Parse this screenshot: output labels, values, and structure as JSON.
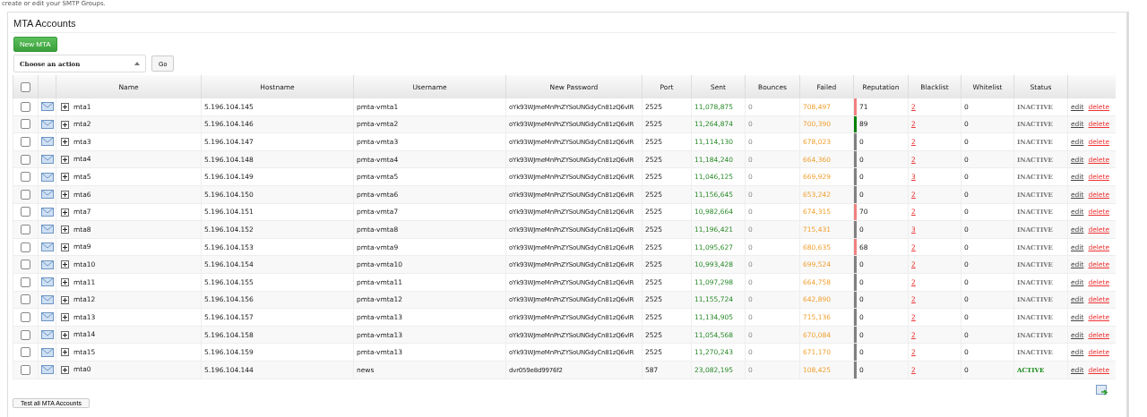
{
  "intro": "create or edit your SMTP Groups.",
  "panel_title": "MTA Accounts",
  "new_button": "New MTA",
  "action_select": {
    "value": "Choose an action"
  },
  "go_button": "Go",
  "header_checked": false,
  "columns": [
    "Name",
    "Hostname",
    "Username",
    "New Password",
    "Port",
    "Sent",
    "Bounces",
    "Failed",
    "Reputation",
    "Blacklist",
    "Whitelist",
    "Status"
  ],
  "rows": [
    {
      "checked": false,
      "name": "mta1",
      "hostname": "5.196.104.145",
      "username": "pmta-vmta1",
      "password": "oYk93WJmeMnPnZYSoUNGdyCn81zQ6vlR",
      "port": "2525",
      "sent": "11,078,875",
      "bounces": "0",
      "failed": "708,497",
      "reputation": "71",
      "color": "#f08080",
      "blacklist": "2",
      "whitelist": "0",
      "status": "INACTIVE",
      "active": false,
      "edit": "edit",
      "delete": "delete"
    },
    {
      "checked": false,
      "name": "mta2",
      "hostname": "5.196.104.146",
      "username": "pmta-vmta2",
      "password": "oYk93WJmeMnPnZYSoUNGdyCn81zQ6vlR",
      "port": "2525",
      "sent": "11,264,874",
      "bounces": "0",
      "failed": "700,390",
      "reputation": "89",
      "color": "#008000",
      "blacklist": "2",
      "whitelist": "0",
      "status": "INACTIVE",
      "active": false,
      "edit": "edit",
      "delete": "delete"
    },
    {
      "checked": false,
      "name": "mta3",
      "hostname": "5.196.104.147",
      "username": "pmta-vmta3",
      "password": "oYk93WJmeMnPnZYSoUNGdyCn81zQ6vlR",
      "port": "2525",
      "sent": "11,114,130",
      "bounces": "0",
      "failed": "678,023",
      "reputation": "0",
      "color": "#808080",
      "blacklist": "2",
      "whitelist": "0",
      "status": "INACTIVE",
      "active": false,
      "edit": "edit",
      "delete": "delete"
    },
    {
      "checked": false,
      "name": "mta4",
      "hostname": "5.196.104.148",
      "username": "pmta-vmta4",
      "password": "oYk93WJmeMnPnZYSoUNGdyCn81zQ6vlR",
      "port": "2525",
      "sent": "11,184,240",
      "bounces": "0",
      "failed": "664,360",
      "reputation": "0",
      "color": "#808080",
      "blacklist": "2",
      "whitelist": "0",
      "status": "INACTIVE",
      "active": false,
      "edit": "edit",
      "delete": "delete"
    },
    {
      "checked": false,
      "name": "mta5",
      "hostname": "5.196.104.149",
      "username": "pmta-vmta5",
      "password": "oYk93WJmeMnPnZYSoUNGdyCn81zQ6vlR",
      "port": "2525",
      "sent": "11,046,125",
      "bounces": "0",
      "failed": "669,929",
      "reputation": "0",
      "color": "#808080",
      "blacklist": "3",
      "whitelist": "0",
      "status": "INACTIVE",
      "active": false,
      "edit": "edit",
      "delete": "delete"
    },
    {
      "checked": false,
      "name": "mta6",
      "hostname": "5.196.104.150",
      "username": "pmta-vmta6",
      "password": "oYk93WJmeMnPnZYSoUNGdyCn81zQ6vlR",
      "port": "2525",
      "sent": "11,156,645",
      "bounces": "0",
      "failed": "653,242",
      "reputation": "0",
      "color": "#808080",
      "blacklist": "2",
      "whitelist": "0",
      "status": "INACTIVE",
      "active": false,
      "edit": "edit",
      "delete": "delete"
    },
    {
      "checked": false,
      "name": "mta7",
      "hostname": "5.196.104.151",
      "username": "pmta-vmta7",
      "password": "oYk93WJmeMnPnZYSoUNGdyCn81zQ6vlR",
      "port": "2525",
      "sent": "10,982,664",
      "bounces": "0",
      "failed": "674,315",
      "reputation": "70",
      "color": "#f08080",
      "blacklist": "2",
      "whitelist": "0",
      "status": "INACTIVE",
      "active": false,
      "edit": "edit",
      "delete": "delete"
    },
    {
      "checked": false,
      "name": "mta8",
      "hostname": "5.196.104.152",
      "username": "pmta-vmta8",
      "password": "oYk93WJmeMnPnZYSoUNGdyCn81zQ6vlR",
      "port": "2525",
      "sent": "11,196,421",
      "bounces": "0",
      "failed": "715,431",
      "reputation": "0",
      "color": "#808080",
      "blacklist": "3",
      "whitelist": "0",
      "status": "INACTIVE",
      "active": false,
      "edit": "edit",
      "delete": "delete"
    },
    {
      "checked": false,
      "name": "mta9",
      "hostname": "5.196.104.153",
      "username": "pmta-vmta9",
      "password": "oYk93WJmeMnPnZYSoUNGdyCn81zQ6vlR",
      "port": "2525",
      "sent": "11,095,627",
      "bounces": "0",
      "failed": "680,635",
      "reputation": "68",
      "color": "#f08080",
      "blacklist": "2",
      "whitelist": "0",
      "status": "INACTIVE",
      "active": false,
      "edit": "edit",
      "delete": "delete"
    },
    {
      "checked": false,
      "name": "mta10",
      "hostname": "5.196.104.154",
      "username": "pmta-vmta10",
      "password": "oYk93WJmeMnPnZYSoUNGdyCn81zQ6vlR",
      "port": "2525",
      "sent": "10,993,428",
      "bounces": "0",
      "failed": "699,524",
      "reputation": "0",
      "color": "#808080",
      "blacklist": "2",
      "whitelist": "0",
      "status": "INACTIVE",
      "active": false,
      "edit": "edit",
      "delete": "delete"
    },
    {
      "checked": false,
      "name": "mta11",
      "hostname": "5.196.104.155",
      "username": "pmta-vmta11",
      "password": "oYk93WJmeMnPnZYSoUNGdyCn81zQ6vlR",
      "port": "2525",
      "sent": "11,097,298",
      "bounces": "0",
      "failed": "664,758",
      "reputation": "0",
      "color": "#808080",
      "blacklist": "2",
      "whitelist": "0",
      "status": "INACTIVE",
      "active": false,
      "edit": "edit",
      "delete": "delete"
    },
    {
      "checked": false,
      "name": "mta12",
      "hostname": "5.196.104.156",
      "username": "pmta-vmta12",
      "password": "oYk93WJmeMnPnZYSoUNGdyCn81zQ6vlR",
      "port": "2525",
      "sent": "11,155,724",
      "bounces": "0",
      "failed": "642,890",
      "reputation": "0",
      "color": "#808080",
      "blacklist": "2",
      "whitelist": "0",
      "status": "INACTIVE",
      "active": false,
      "edit": "edit",
      "delete": "delete"
    },
    {
      "checked": false,
      "name": "mta13",
      "hostname": "5.196.104.157",
      "username": "pmta-vmta13",
      "password": "oYk93WJmeMnPnZYSoUNGdyCn81zQ6vlR",
      "port": "2525",
      "sent": "11,134,905",
      "bounces": "0",
      "failed": "715,136",
      "reputation": "0",
      "color": "#808080",
      "blacklist": "2",
      "whitelist": "0",
      "status": "INACTIVE",
      "active": false,
      "edit": "edit",
      "delete": "delete"
    },
    {
      "checked": false,
      "name": "mta14",
      "hostname": "5.196.104.158",
      "username": "pmta-vmta13",
      "password": "oYk93WJmeMnPnZYSoUNGdyCn81zQ6vlR",
      "port": "2525",
      "sent": "11,054,568",
      "bounces": "0",
      "failed": "670,084",
      "reputation": "0",
      "color": "#808080",
      "blacklist": "2",
      "whitelist": "0",
      "status": "INACTIVE",
      "active": false,
      "edit": "edit",
      "delete": "delete"
    },
    {
      "checked": false,
      "name": "mta15",
      "hostname": "5.196.104.159",
      "username": "pmta-vmta13",
      "password": "oYk93WJmeMnPnZYSoUNGdyCn81zQ6vlR",
      "port": "2525",
      "sent": "11,270,243",
      "bounces": "0",
      "failed": "671,170",
      "reputation": "0",
      "color": "#808080",
      "blacklist": "2",
      "whitelist": "0",
      "status": "INACTIVE",
      "active": false,
      "edit": "edit",
      "delete": "delete"
    },
    {
      "checked": false,
      "name": "mta0",
      "hostname": "5.196.104.144",
      "username": "news",
      "password": "dvr059e8d9976f2",
      "port": "587",
      "sent": "23,082,195",
      "bounces": "0",
      "failed": "108,425",
      "reputation": "0",
      "color": "#808080",
      "blacklist": "2",
      "whitelist": "0",
      "status": "ACTIVE",
      "active": true,
      "edit": "edit",
      "delete": "delete"
    }
  ],
  "test_button": "Test all MTA Accounts"
}
